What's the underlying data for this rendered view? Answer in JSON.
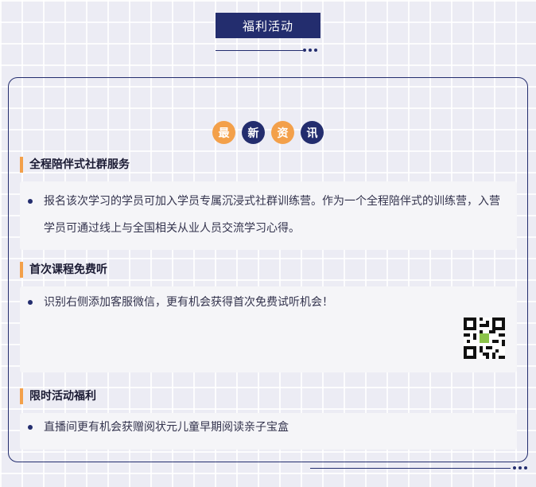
{
  "header": {
    "title": "福利活动"
  },
  "news_chars": [
    {
      "char": "最",
      "color": "#f3a04a"
    },
    {
      "char": "新",
      "color": "#232d6e"
    },
    {
      "char": "资",
      "color": "#f3a04a"
    },
    {
      "char": "讯",
      "color": "#232d6e"
    }
  ],
  "sections": [
    {
      "title": "全程陪伴式社群服务",
      "text": "报名该次学习的学员可加入学员专属沉浸式社群训练营。作为一个全程陪伴式的训练营，入营学员可通过线上与全国相关从业人员交流学习心得。"
    },
    {
      "title": "首次课程免费听",
      "text": "识别右侧添加客服微信，更有机会获得首次免费试听机会！"
    },
    {
      "title": "限时活动福利",
      "text": "直播间更有机会获赠阅状元儿童早期阅读亲子宝盒"
    }
  ],
  "icons": {
    "qr": "qr-code-icon"
  },
  "colors": {
    "navy": "#232d6e",
    "orange": "#f3a04a",
    "card": "#f5f5f8"
  }
}
